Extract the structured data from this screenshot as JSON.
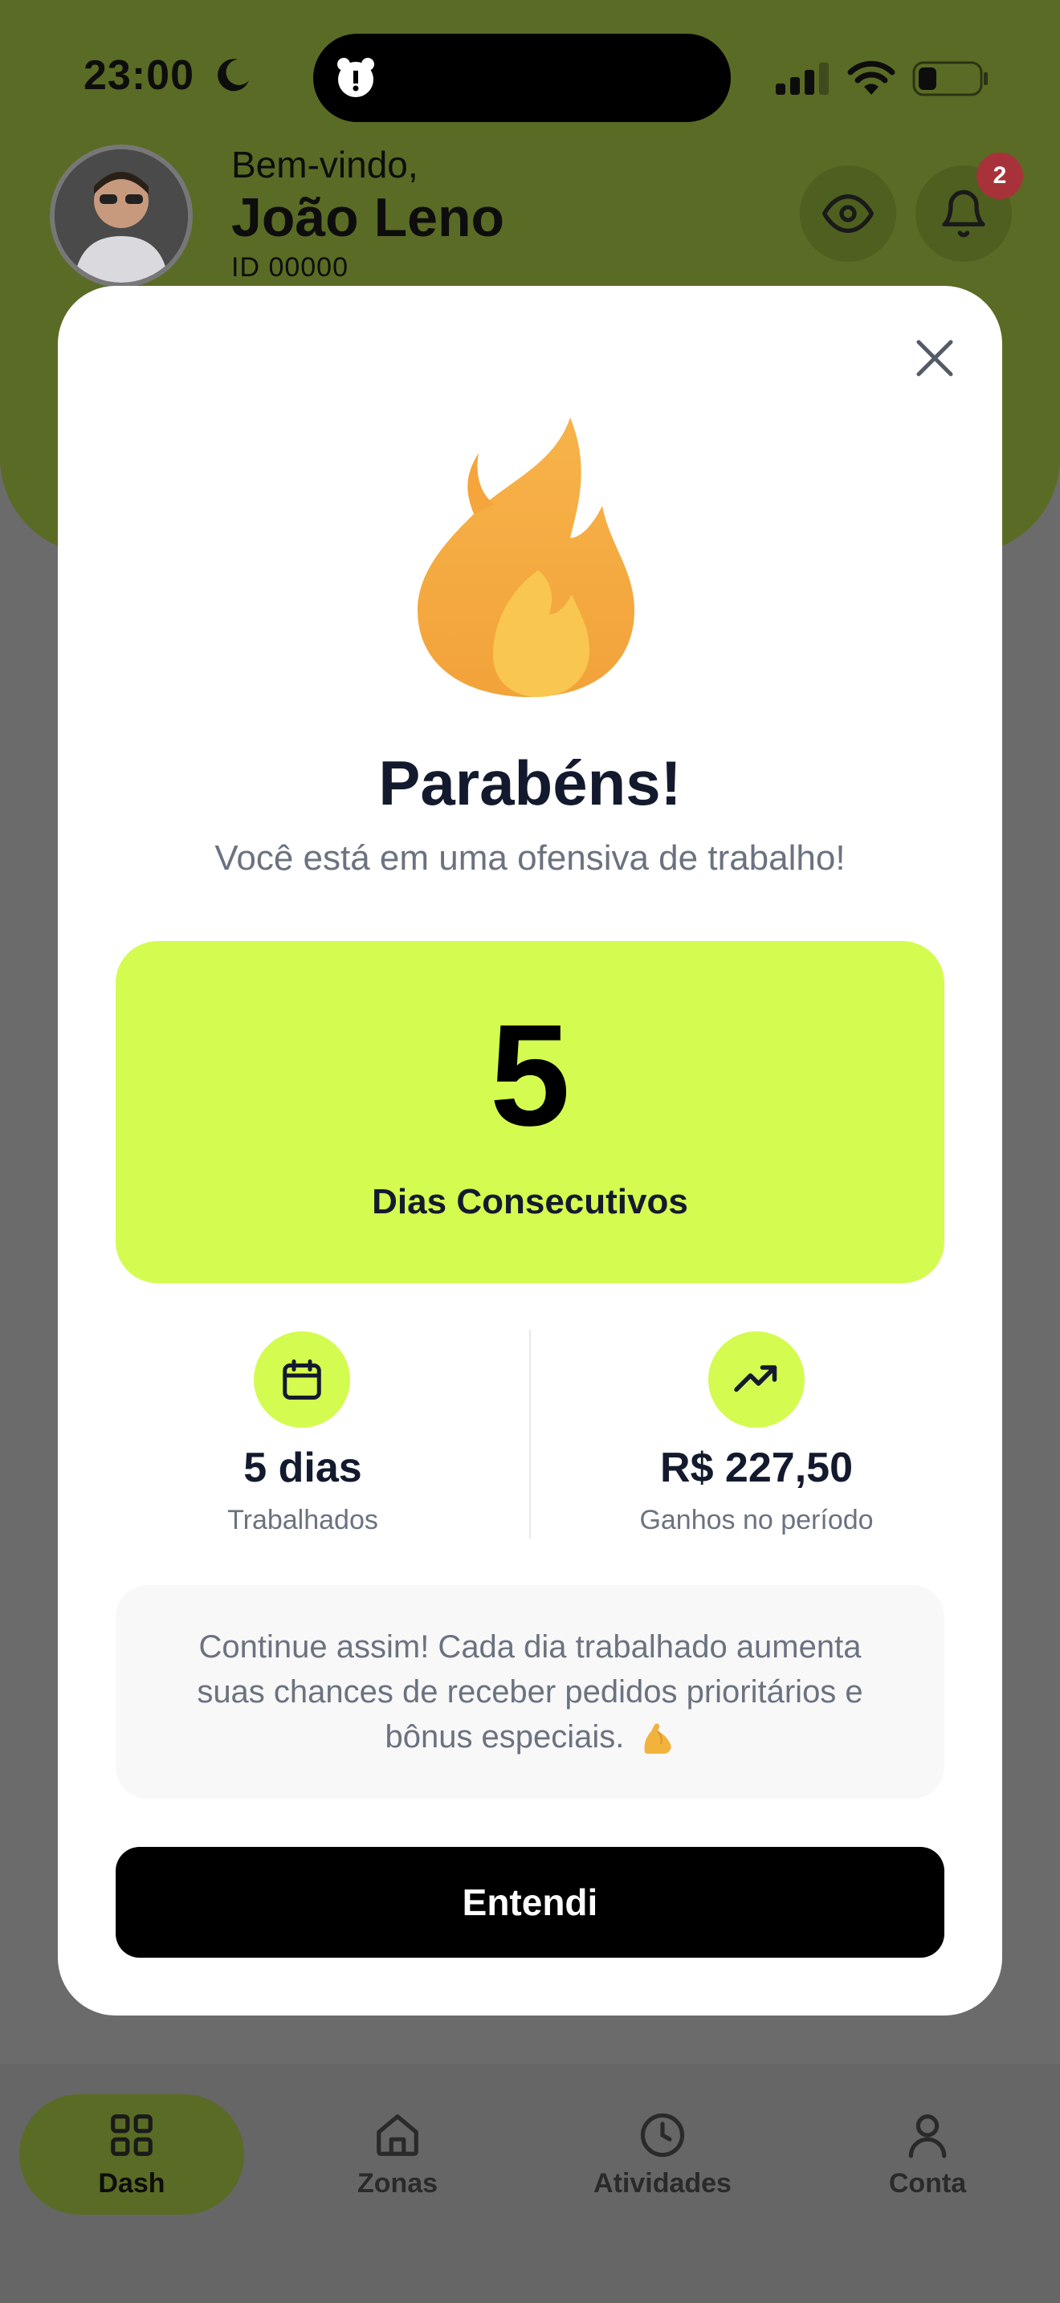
{
  "status_bar": {
    "time": "23:00",
    "icons": [
      "moon-icon",
      "signal-icon",
      "wifi-icon",
      "battery-icon"
    ]
  },
  "header": {
    "welcome": "Bem-vindo,",
    "name": "João Leno",
    "id_text": "ID 00000",
    "notification_count": "2",
    "accent_color": "#c6f04a"
  },
  "modal": {
    "title": "Parabéns!",
    "subtitle": "Você está em uma ofensiva de trabalho!",
    "streak_value": "5",
    "streak_label": "Dias Consecutivos",
    "stats": [
      {
        "icon": "calendar-icon",
        "value": "5 dias",
        "label": "Trabalhados"
      },
      {
        "icon": "trending-up-icon",
        "value": "R$ 227,50",
        "label": "Ganhos no período"
      }
    ],
    "info_text": "Continue assim! Cada dia trabalhado aumenta suas chances de receber pedidos prioritários e bônus especiais.",
    "button_label": "Entendi",
    "card_color": "#d4fb4f"
  },
  "bottom_nav": {
    "items": [
      {
        "label": "Dash",
        "icon": "grid-icon",
        "active": true
      },
      {
        "label": "Zonas",
        "icon": "home-icon",
        "active": false
      },
      {
        "label": "Atividades",
        "icon": "clock-icon",
        "active": false
      },
      {
        "label": "Conta",
        "icon": "user-icon",
        "active": false
      }
    ]
  }
}
